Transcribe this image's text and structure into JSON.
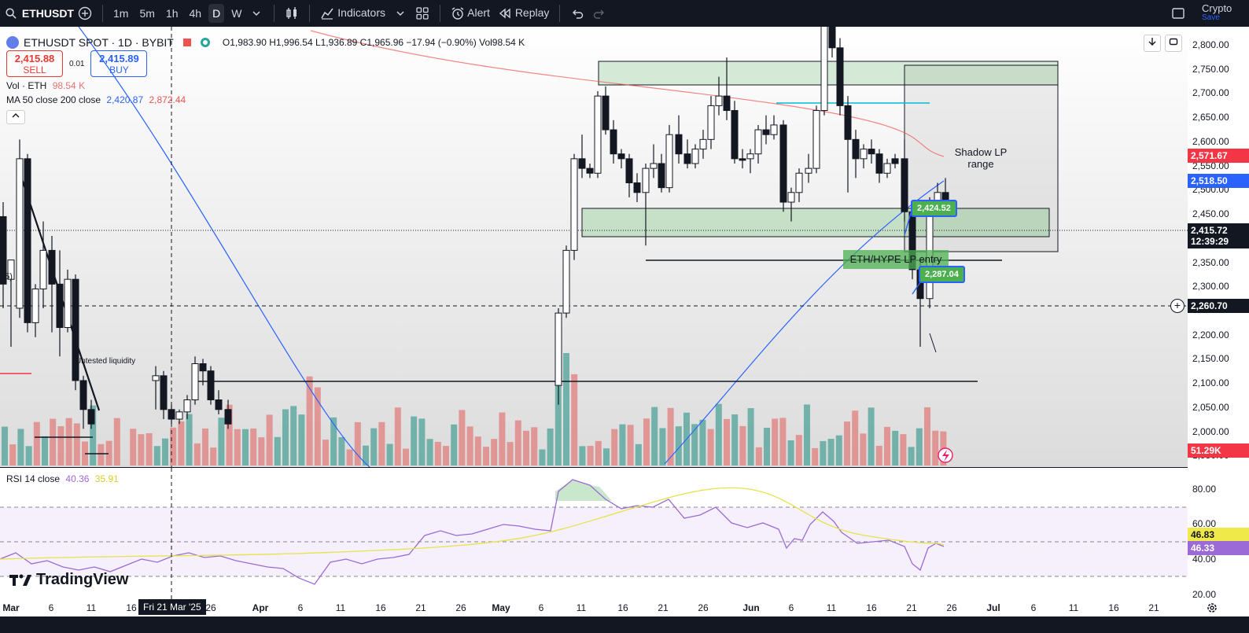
{
  "toolbar": {
    "symbol": "ETHUSDT",
    "intervals": [
      "1m",
      "5m",
      "1h",
      "4h",
      "D",
      "W"
    ],
    "active_interval": "D",
    "indicators_label": "Indicators",
    "alert_label": "Alert",
    "replay_label": "Replay",
    "right_label": "Crypto",
    "save_label": "Save"
  },
  "legend": {
    "title": "ETHUSDT SPOT · 1D · BYBIT",
    "ohlc": "O1,983.90 H1,996.54 L1,936.89 C1,965.96 −17.94 (−0.90%) Vol98.54 K",
    "sell_price": "2,415.88",
    "sell_label": "SELL",
    "spread": "0.01",
    "buy_price": "2,415.89",
    "buy_label": "BUY",
    "vol_label": "Vol · ETH",
    "vol_value": "98.54 K",
    "ma_label": "MA 50 close 200 close",
    "ma50_value": "2,420.87",
    "ma200_value": "2,872.44"
  },
  "rsi_legend": {
    "label": "RSI 14 close",
    "rsi_value": "40.36",
    "rsi_ma_value": "35.91"
  },
  "price_axis": {
    "labels": [
      "2,800.00",
      "2,750.00",
      "2,700.00",
      "2,650.00",
      "2,600.00",
      "2,550.00",
      "2,500.00",
      "2,450.00",
      "2,350.00",
      "2,300.00",
      "2,200.00",
      "2,150.00",
      "2,100.00",
      "2,050.00",
      "2,000.00",
      "1,950.00"
    ],
    "tags": {
      "ma200": "2,571.67",
      "ma50": "2,518.50",
      "last_price": "2,415.72",
      "countdown": "12:39:29",
      "crosshair": "2,260.70",
      "volume": "51.29K"
    }
  },
  "rsi_axis": {
    "labels": [
      "80.00",
      "60.00",
      "40.00",
      "20.00"
    ],
    "tags": {
      "rsi_ma": "46.83",
      "rsi": "46.33"
    }
  },
  "time_axis": {
    "labels": [
      "Mar",
      "6",
      "11",
      "16",
      "26",
      "Apr",
      "6",
      "11",
      "16",
      "21",
      "26",
      "May",
      "6",
      "11",
      "16",
      "21",
      "26",
      "Jun",
      "6",
      "11",
      "16",
      "21",
      "26",
      "Jul",
      "6",
      "11",
      "16",
      "21"
    ],
    "crosshair_date": "Fri 21 Mar '25"
  },
  "annotations": {
    "shadow_lp": "Shadow LP\nrange",
    "eth_hype": "ETH/HYPE LP entry",
    "badge_top": "2,424.52",
    "badge_bottom": "2,287.04",
    "liquidity": "Untested liquidity",
    "left_cut": "45)"
  },
  "logo_text": "TradingView",
  "colors": {
    "bull": "#ffffff",
    "bear": "#131722",
    "vol_up": "#5ea9a0",
    "vol_down": "#e08a87",
    "ma50": "#2962ff",
    "ma200": "#ef5350",
    "rsi": "#9c6ad6",
    "rsi_ma": "#e6e34a",
    "zone": "#4caf50"
  }
}
